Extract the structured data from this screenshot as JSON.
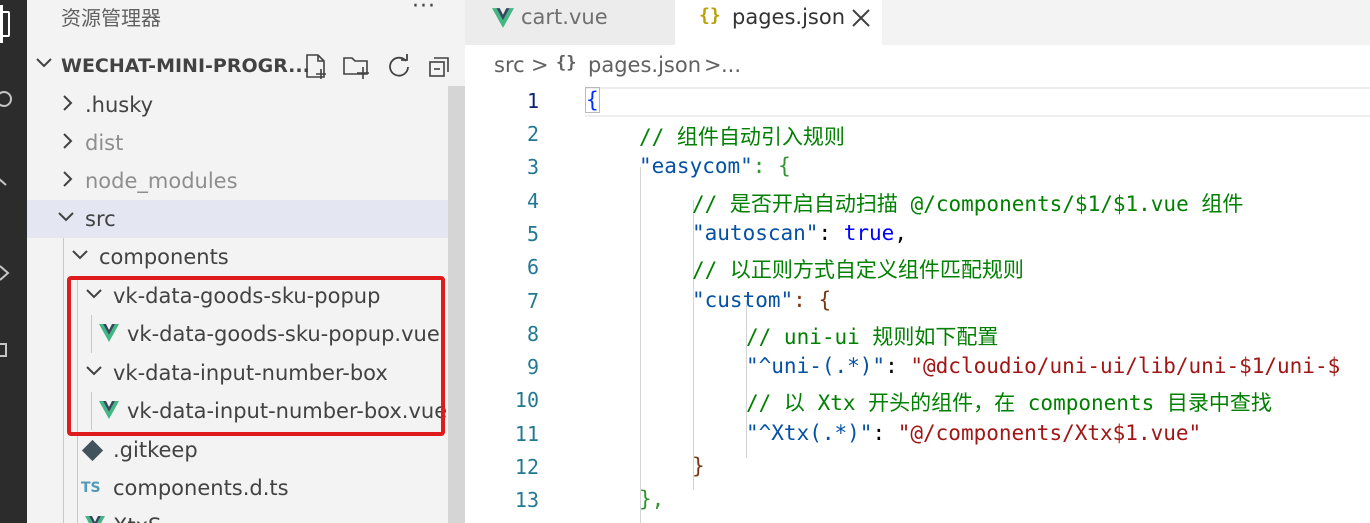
{
  "sidebar": {
    "title": "资源管理器",
    "more": "···",
    "workspace": "WECHAT-MINI-PROGR...",
    "toolbar": [
      "new-file-icon",
      "new-folder-icon",
      "refresh-icon",
      "collapse-all-icon"
    ],
    "tree": [
      {
        "label": ".husky",
        "dim": false
      },
      {
        "label": "dist",
        "dim": true
      },
      {
        "label": "node_modules",
        "dim": true
      },
      {
        "label": "src",
        "dim": false
      },
      {
        "label": "components",
        "dim": false
      },
      {
        "label": "vk-data-goods-sku-popup",
        "dim": false
      },
      {
        "label": "vk-data-goods-sku-popup.vue",
        "dim": false
      },
      {
        "label": "vk-data-input-number-box",
        "dim": false
      },
      {
        "label": "vk-data-input-number-box.vue",
        "dim": false
      },
      {
        "label": ".gitkeep",
        "dim": false
      },
      {
        "label": "components.d.ts",
        "dim": false
      },
      {
        "label": "XtxS...",
        "dim": false
      }
    ],
    "ts_badge": "TS"
  },
  "tabs": [
    {
      "label": "cart.vue",
      "active": false
    },
    {
      "label": "pages.json",
      "active": true
    }
  ],
  "breadcrumb": {
    "folder": "src",
    "sep": ">",
    "file": "pages.json",
    "tail": "...",
    "json_icon": "{}"
  },
  "editor": {
    "line_numbers": [
      "1",
      "2",
      "3",
      "4",
      "5",
      "6",
      "7",
      "8",
      "9",
      "10",
      "11",
      "12",
      "13"
    ],
    "lines": {
      "l1": "{",
      "l2": "// 组件自动引入规则",
      "l3_key": "\"easycom\"",
      "l3_rest": ": {",
      "l4": "// 是否开启自动扫描 @/components/$1/$1.vue 组件",
      "l5_key": "\"autoscan\"",
      "l5_colon": ": ",
      "l5_val": "true",
      "l5_end": ",",
      "l6": "// 以正则方式自定义组件匹配规则",
      "l7_key": "\"custom\"",
      "l7_rest": ": {",
      "l8": "// uni-ui 规则如下配置",
      "l9_key": "\"^uni-(.*)\"",
      "l9_colon": ": ",
      "l9_val": "\"@dcloudio/uni-ui/lib/uni-$1/uni-$",
      "l10": "// 以 Xtx 开头的组件，在 components 目录中查找",
      "l11_key": "\"^Xtx(.*)\"",
      "l11_colon": ": ",
      "l11_val": "\"@/components/Xtx$1.vue\"",
      "l12": "}",
      "l13": "},"
    }
  },
  "colors": {
    "highlight_box": "#e01b1b",
    "vue_green": "#41b883",
    "comment": "#008000",
    "key": "#0451a5",
    "string": "#a31515"
  }
}
